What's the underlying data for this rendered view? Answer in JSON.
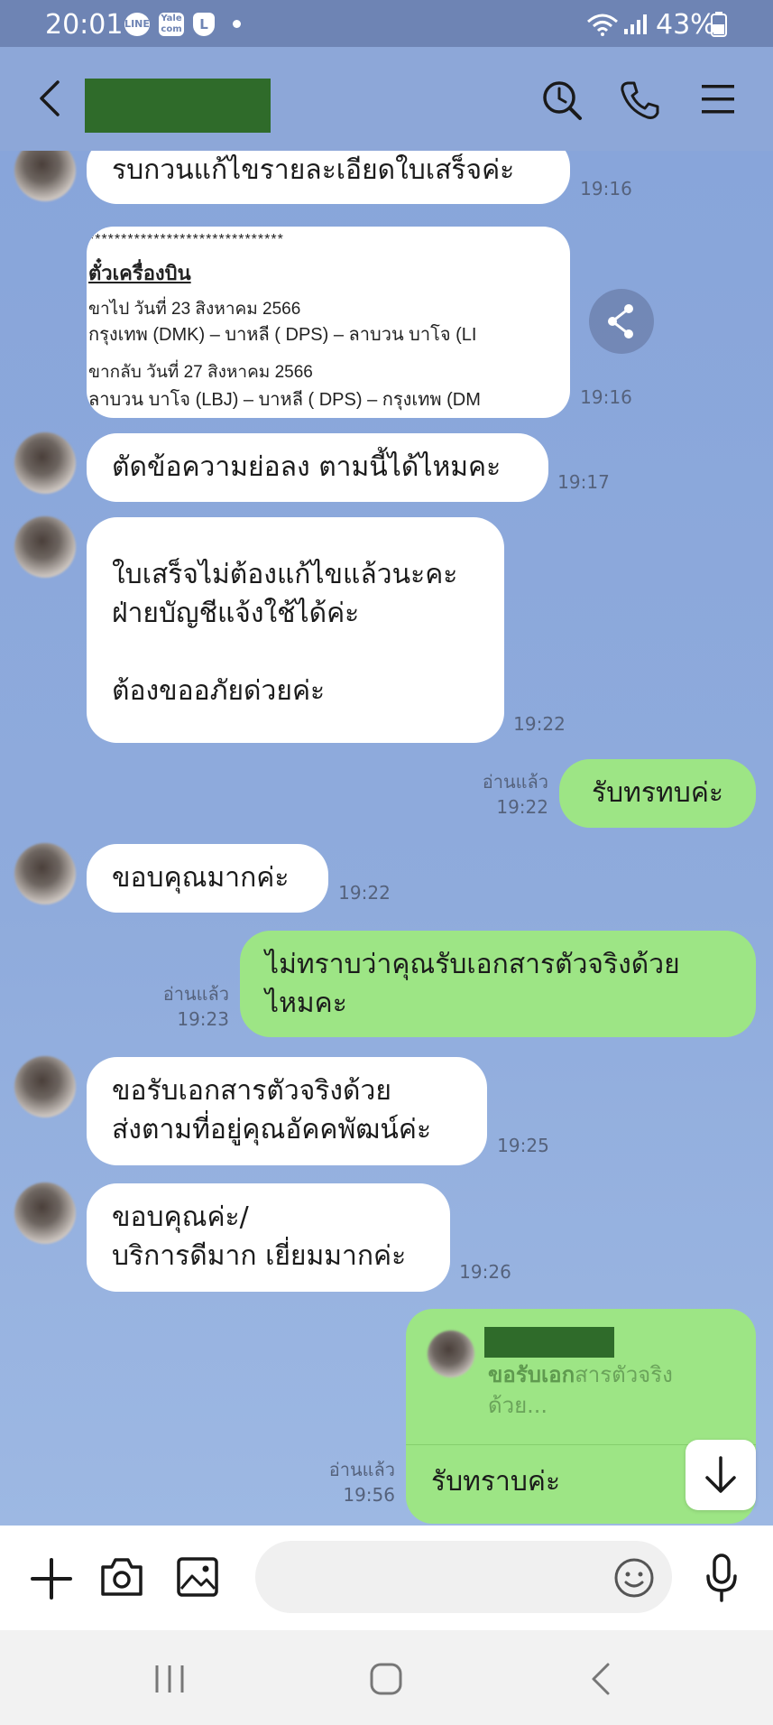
{
  "status_bar": {
    "time": "20:01",
    "icons": [
      "line-notification-icon",
      "yale-icon",
      "l-app-icon"
    ],
    "battery": "43%",
    "icon_labels": {
      "line": "LINE",
      "yale": "Yale com",
      "l": "L"
    }
  },
  "header": {
    "back_icon": "chevron-left-icon",
    "icons": [
      "search-history-icon",
      "phone-icon",
      "menu-icon"
    ]
  },
  "messages": [
    {
      "from": "them",
      "text": "รบกวนแก้ไขรายละเอียดใบเสร็จค่ะ",
      "time": "19:16"
    },
    {
      "from": "them",
      "type": "image",
      "time": "19:16",
      "image_lines": [
        "******************************",
        "ตั๋วเครื่องบิน",
        "ขาไป วันที่ 23 สิงหาคม 2566",
        "กรุงเทพ (DMK) – บาหลี ( DPS) – ลาบวน บาโจ (LI",
        "ขากลับ วันที่ 27 สิงหาคม 2566",
        "ลาบวน บาโจ (LBJ) – บาหลี ( DPS) – กรุงเทพ (DM"
      ]
    },
    {
      "from": "them",
      "text": "ตัดข้อความย่อลง ตามนี้ได้ไหมคะ",
      "time": "19:17"
    },
    {
      "from": "them",
      "text": "ใบเสร็จไม่ต้องแก้ไขแล้วนะคะ\nฝ่ายบัญชีแจ้งใช้ได้ค่ะ\n\nต้องขออภัยด่วยค่ะ",
      "time": "19:22"
    },
    {
      "from": "me",
      "text": "รับทรทบค่ะ",
      "read": "อ่านแล้ว",
      "time": "19:22"
    },
    {
      "from": "them",
      "text": "ขอบคุณมากค่ะ",
      "time": "19:22"
    },
    {
      "from": "me",
      "text": "ไม่ทราบว่าคุณรับเอกสารตัวจริงด้วย\nไหมคะ",
      "read": "อ่านแล้ว",
      "time": "19:23"
    },
    {
      "from": "them",
      "text": "ขอรับเอกสารตัวจริงด้วย\nส่งตามที่อยู่คุณอัคคพัฒน์ค่ะ",
      "time": "19:25"
    },
    {
      "from": "them",
      "text": "ขอบคุณค่ะ/\nบริการดีมาก เยี่ยมมากค่ะ",
      "time": "19:26"
    },
    {
      "from": "me",
      "type": "reply",
      "quote_highlight": "ขอรับเอก",
      "quote_rest": "สารตัวจริง",
      "quote_line2": "ด้วย...",
      "text": "รับทราบค่ะ",
      "read": "อ่านแล้ว",
      "time": "19:56"
    }
  ],
  "input_bar": {
    "icons": [
      "plus-icon",
      "camera-icon",
      "image-icon",
      "emoji-icon",
      "microphone-icon"
    ],
    "placeholder": ""
  },
  "nav_bar": {
    "icons": [
      "recent-apps-icon",
      "home-icon",
      "back-icon"
    ]
  },
  "colors": {
    "header_bg": "#8da7d8",
    "my_bubble": "#9de585",
    "their_bubble": "#ffffff",
    "status_bg": "#6e84b4"
  }
}
